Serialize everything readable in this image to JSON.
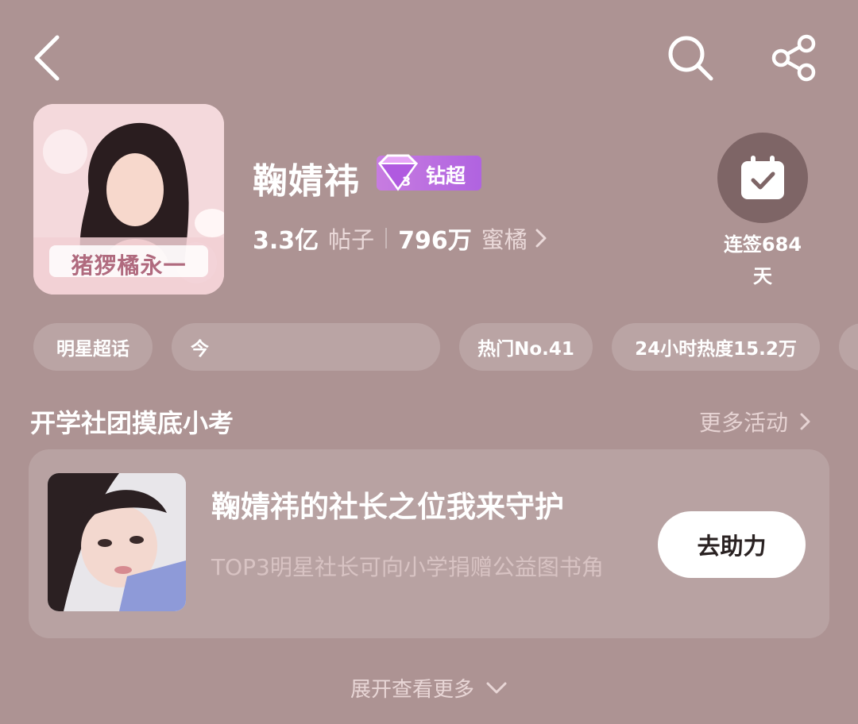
{
  "header": {
    "back_icon": "chevron-left-icon",
    "search_icon": "search-icon",
    "share_icon": "share-icon"
  },
  "profile": {
    "name": "鞠婧祎",
    "badge_label": "钻超",
    "posts_count": "3.3亿",
    "posts_label": "帖子",
    "fans_count": "796万",
    "fans_label": "蜜橘",
    "avatar_caption": "猪猡橘永一",
    "checkin_line1": "连签684",
    "checkin_line2": "天"
  },
  "chips": [
    {
      "label": "明星超话"
    },
    {
      "label": "今"
    },
    {
      "label": "热门No.41"
    },
    {
      "label": "24小时热度15.2万"
    }
  ],
  "section": {
    "title": "开学社团摸底小考",
    "more_label": "更多活动"
  },
  "card": {
    "title": "鞠婧祎的社长之位我来守护",
    "description": "TOP3明星社长可向小学捐赠公益图书角",
    "button_label": "去助力"
  },
  "footer": {
    "expand_label": "展开查看更多"
  },
  "colors": {
    "background": "#ad9393",
    "badge": "#c77ce0",
    "checkin_circle": "#7e6566"
  }
}
